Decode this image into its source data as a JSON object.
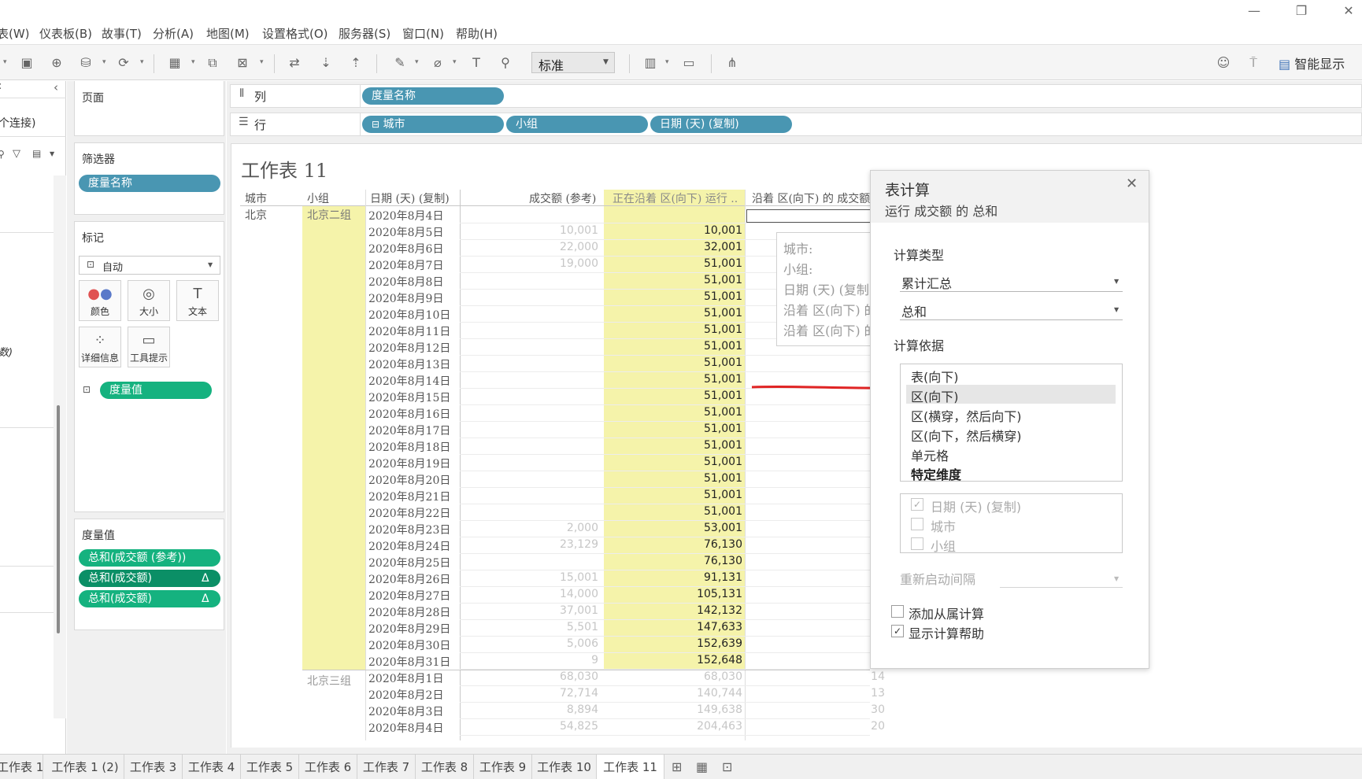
{
  "menu": [
    "表(W)",
    "仪表板(B)",
    "故事(T)",
    "分析(A)",
    "地图(M)",
    "设置格式(O)",
    "服务器(S)",
    "窗口(N)",
    "帮助(H)"
  ],
  "toolbar": {
    "fit_select": "标准",
    "show_me": "智能显示"
  },
  "datapane": {
    "connection_text": "个连接)",
    "measure_fragment": "数)"
  },
  "pages_label": "页面",
  "filters": {
    "title": "筛选器",
    "pill": "度量名称"
  },
  "marks": {
    "title": "标记",
    "type": "自动",
    "buttons": [
      "颜色",
      "大小",
      "文本",
      "详细信息",
      "工具提示"
    ],
    "pill": "度量值"
  },
  "measure_values": {
    "title": "度量值",
    "pills": [
      "总和(成交额 (参考))",
      "总和(成交额)",
      "总和(成交额)"
    ],
    "delta": "Δ"
  },
  "columns_shelf": {
    "label": "列",
    "pills": [
      "度量名称"
    ]
  },
  "rows_shelf": {
    "label": "行",
    "pills": [
      "城市",
      "小组",
      "日期 (天) (复制)"
    ]
  },
  "sheet_title": "工作表 11",
  "table": {
    "headers": {
      "city": "城市",
      "group": "小组",
      "date": "日期 (天) (复制)",
      "ref": "成交额 (参考)",
      "running": "正在沿着 区(向下) 运行 ..",
      "pane": "沿着 区(向下) 的 成交额"
    },
    "city": "北京",
    "group1": "北京二组",
    "group2": "北京三组",
    "rows1": [
      {
        "date": "2020年8月4日",
        "ref": "",
        "run": ""
      },
      {
        "date": "2020年8月5日",
        "ref": "10,001",
        "run": "10,001"
      },
      {
        "date": "2020年8月6日",
        "ref": "22,000",
        "run": "32,001"
      },
      {
        "date": "2020年8月7日",
        "ref": "19,000",
        "run": "51,001"
      },
      {
        "date": "2020年8月8日",
        "ref": "",
        "run": "51,001"
      },
      {
        "date": "2020年8月9日",
        "ref": "",
        "run": "51,001"
      },
      {
        "date": "2020年8月10日",
        "ref": "",
        "run": "51,001"
      },
      {
        "date": "2020年8月11日",
        "ref": "",
        "run": "51,001"
      },
      {
        "date": "2020年8月12日",
        "ref": "",
        "run": "51,001"
      },
      {
        "date": "2020年8月13日",
        "ref": "",
        "run": "51,001"
      },
      {
        "date": "2020年8月14日",
        "ref": "",
        "run": "51,001"
      },
      {
        "date": "2020年8月15日",
        "ref": "",
        "run": "51,001"
      },
      {
        "date": "2020年8月16日",
        "ref": "",
        "run": "51,001"
      },
      {
        "date": "2020年8月17日",
        "ref": "",
        "run": "51,001"
      },
      {
        "date": "2020年8月18日",
        "ref": "",
        "run": "51,001"
      },
      {
        "date": "2020年8月19日",
        "ref": "",
        "run": "51,001"
      },
      {
        "date": "2020年8月20日",
        "ref": "",
        "run": "51,001"
      },
      {
        "date": "2020年8月21日",
        "ref": "",
        "run": "51,001"
      },
      {
        "date": "2020年8月22日",
        "ref": "",
        "run": "51,001"
      },
      {
        "date": "2020年8月23日",
        "ref": "2,000",
        "run": "53,001"
      },
      {
        "date": "2020年8月24日",
        "ref": "23,129",
        "run": "76,130"
      },
      {
        "date": "2020年8月25日",
        "ref": "",
        "run": "76,130"
      },
      {
        "date": "2020年8月26日",
        "ref": "15,001",
        "run": "91,131"
      },
      {
        "date": "2020年8月27日",
        "ref": "14,000",
        "run": "105,131"
      },
      {
        "date": "2020年8月28日",
        "ref": "37,001",
        "run": "142,132"
      },
      {
        "date": "2020年8月29日",
        "ref": "5,501",
        "run": "147,633"
      },
      {
        "date": "2020年8月30日",
        "ref": "5,006",
        "run": "152,639"
      },
      {
        "date": "2020年8月31日",
        "ref": "9",
        "run": "152,648"
      }
    ],
    "rows2": [
      {
        "date": "2020年8月1日",
        "ref": "68,030",
        "run": "68,030",
        "pane": "14"
      },
      {
        "date": "2020年8月2日",
        "ref": "72,714",
        "run": "140,744",
        "pane": "13"
      },
      {
        "date": "2020年8月3日",
        "ref": "8,894",
        "run": "149,638",
        "pane": "30"
      },
      {
        "date": "2020年8月4日",
        "ref": "54,825",
        "run": "204,463",
        "pane": "20"
      }
    ]
  },
  "tooltip": {
    "lines": [
      "城市:",
      "小组:",
      "日期 (天) (复制",
      "沿着 区(向下) 的",
      "沿着 区(向下) 的"
    ]
  },
  "dialog": {
    "title": "表计算",
    "subtitle": "运行 成交额 的 总和",
    "calc_type_label": "计算类型",
    "calc_type": "累计汇总",
    "aggregation": "总和",
    "compute_using_label": "计算依据",
    "compute_options": [
      "表(向下)",
      "区(向下)",
      "区(横穿，然后向下)",
      "区(向下，然后横穿)",
      "单元格",
      "特定维度"
    ],
    "selected_option": "区(向下)",
    "dimensions": [
      "日期 (天) (复制)",
      "城市",
      "小组"
    ],
    "restart_label": "重新启动间隔",
    "secondary_calc": "添加从属计算",
    "show_help": "显示计算帮助"
  },
  "tabs": [
    "工作表 1",
    "工作表 1 (2)",
    "工作表 3",
    "工作表 4",
    "工作表 5",
    "工作表 6",
    "工作表 7",
    "工作表 8",
    "工作表 9",
    "工作表 10",
    "工作表 11"
  ],
  "colors": {
    "pill_blue": "#4996b2",
    "pill_green": "#15b27f",
    "highlight_yellow": "#f5f3aa",
    "arrow_red": "#e02424"
  }
}
